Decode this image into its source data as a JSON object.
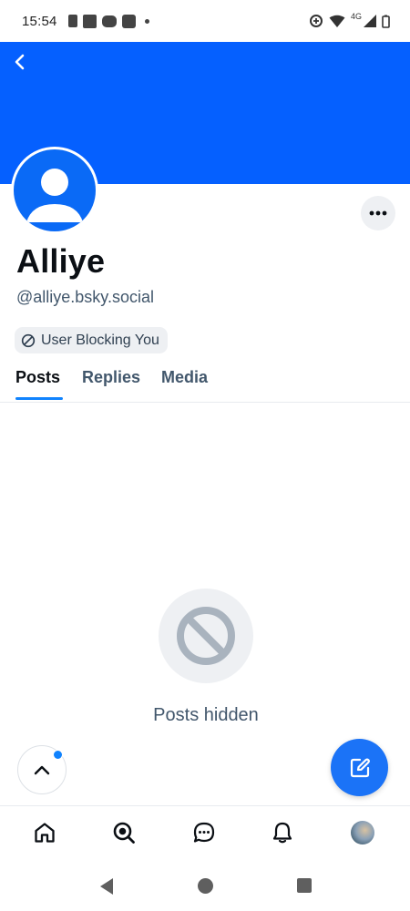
{
  "status_bar": {
    "time": "15:54",
    "network": "4G"
  },
  "profile": {
    "display_name": "Alliye",
    "handle": "@alliye.bsky.social",
    "blocking_label": "User Blocking You",
    "banner_color": "#0560ff",
    "avatar_color": "#0a6af6"
  },
  "tabs": [
    {
      "label": "Posts",
      "active": true
    },
    {
      "label": "Replies",
      "active": false
    },
    {
      "label": "Media",
      "active": false
    }
  ],
  "empty_state": {
    "label": "Posts hidden",
    "icon": "blocked-icon"
  },
  "bottom_nav": [
    {
      "name": "home-icon"
    },
    {
      "name": "search-icon"
    },
    {
      "name": "chat-icon"
    },
    {
      "name": "bell-icon"
    },
    {
      "name": "profile-avatar"
    }
  ],
  "colors": {
    "accent": "#1083fe",
    "compose": "#1b73f7",
    "muted_text": "#42576c"
  }
}
